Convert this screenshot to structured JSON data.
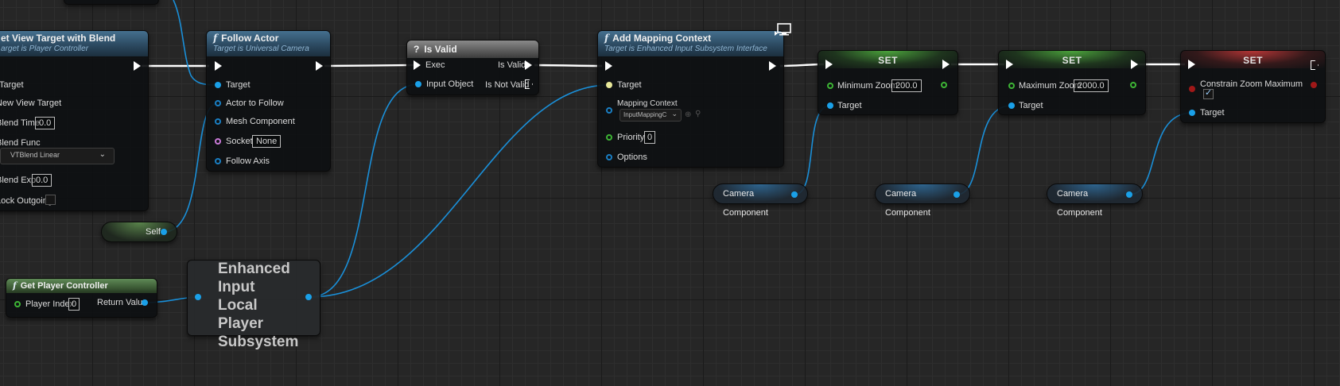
{
  "nodes": {
    "set_view_target": {
      "title": "et View Target with Blend",
      "subtitle": "arget is Player Controller",
      "target": "Target",
      "new_view_target": "New View Target",
      "blend_time_label": "Blend Time",
      "blend_time_value": "0.0",
      "blend_func_label": "Blend Func",
      "blend_func_value": "VTBlend Linear",
      "blend_exp_label": "Blend Exp",
      "blend_exp_value": "0.0",
      "lock_outgoing_label": "Lock Outgoing"
    },
    "follow_actor": {
      "icon": "f",
      "title": "Follow Actor",
      "subtitle": "Target is Universal Camera",
      "target": "Target",
      "actor_to_follow": "Actor to Follow",
      "mesh_component": "Mesh Component",
      "socket_label": "Socket",
      "socket_value": "None",
      "follow_axis": "Follow Axis"
    },
    "is_valid": {
      "icon": "?",
      "title": "Is Valid",
      "exec": "Exec",
      "is_valid_out": "Is Valid",
      "input_object": "Input Object",
      "is_not_valid": "Is Not Valid"
    },
    "add_mapping_context": {
      "icon": "f",
      "title": "Add Mapping Context",
      "subtitle": "Target is Enhanced Input Subsystem Interface",
      "target": "Target",
      "mapping_context_label": "Mapping Context",
      "mapping_context_value": "InputMappingC",
      "priority_label": "Priority",
      "priority_value": "0",
      "options": "Options"
    },
    "set_min_zoom": {
      "title": "SET",
      "field_label": "Minimum Zoom",
      "field_value": "200.0",
      "target": "Target"
    },
    "set_max_zoom": {
      "title": "SET",
      "field_label": "Maximum Zoom",
      "field_value": "2000.0",
      "target": "Target"
    },
    "set_constrain": {
      "title": "SET",
      "field_label": "Constrain Zoom Maximum",
      "checked": true,
      "target": "Target"
    },
    "get_player_controller": {
      "icon": "f",
      "title": "Get Player Controller",
      "player_index_label": "Player Index",
      "player_index_value": "0",
      "return_value": "Return Value"
    },
    "enhanced_input": {
      "title": "Enhanced Input Local Player Subsystem"
    },
    "self": {
      "label": "Self"
    },
    "camera_1": {
      "label": "Camera Component"
    },
    "camera_2": {
      "label": "Camera Component"
    },
    "camera_3": {
      "label": "Camera Component"
    }
  },
  "colors": {
    "exec_wire": "#ffffff",
    "object_wire": "#1a8fd8",
    "accent_green": "#3db535",
    "accent_red": "#a01818"
  },
  "icons": {
    "top_right": "monitor-icon"
  }
}
